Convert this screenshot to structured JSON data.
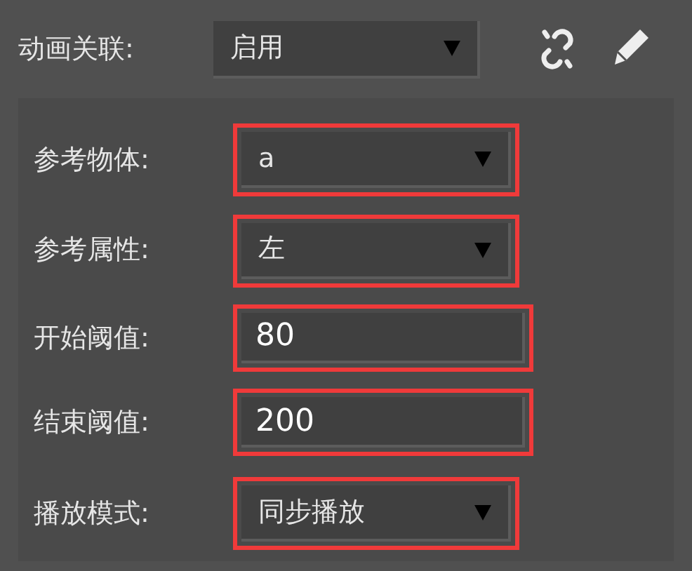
{
  "animation_link": {
    "label": "动画关联:",
    "value": "启用"
  },
  "rows": [
    {
      "kind": "select",
      "label": "参考物体:",
      "value": "a",
      "highlighted": true
    },
    {
      "kind": "select",
      "label": "参考属性:",
      "value": "左",
      "highlighted": true
    },
    {
      "kind": "input",
      "label": "开始阈值:",
      "value": "80",
      "highlighted": true
    },
    {
      "kind": "input",
      "label": "结束阈值:",
      "value": "200",
      "highlighted": true
    },
    {
      "kind": "select",
      "label": "播放模式:",
      "value": "同步播放",
      "highlighted": true
    }
  ]
}
